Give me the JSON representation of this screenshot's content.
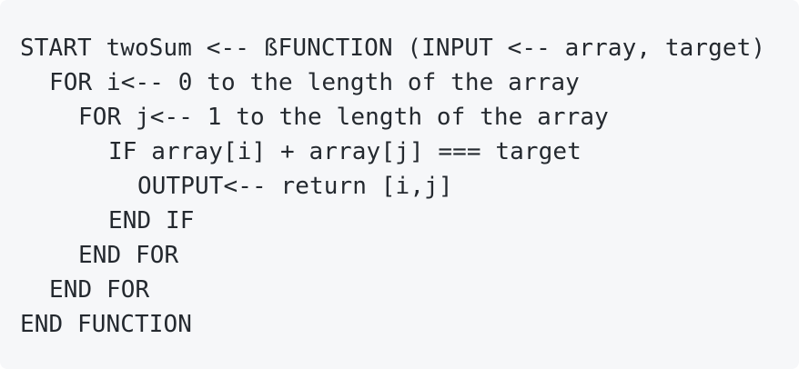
{
  "code": {
    "lines": [
      "START twoSum <-- ßFUNCTION (INPUT <-- array, target)",
      "FOR i<-- 0 to the length of the array",
      "FOR j<-- 1 to the length of the array",
      "IF array[i] + array[j] === target",
      "OUTPUT<-- return [i,j]",
      "END IF",
      "END FOR",
      "END FOR",
      "END FUNCTION"
    ]
  }
}
